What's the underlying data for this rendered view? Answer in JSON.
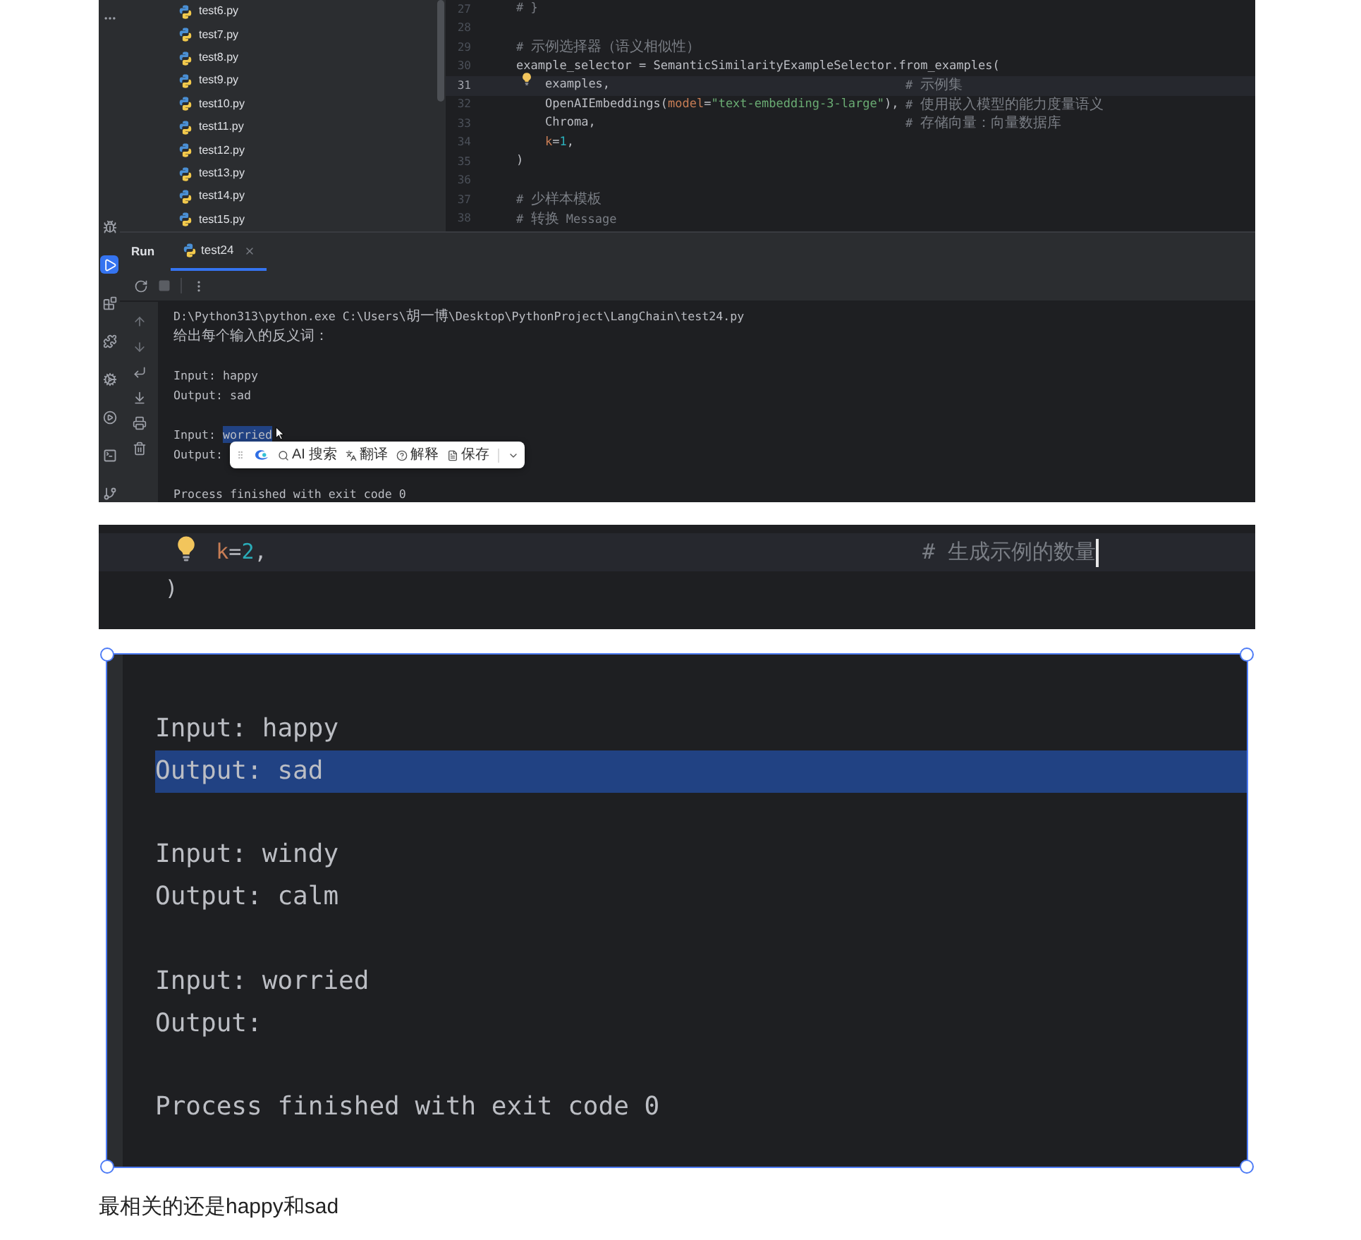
{
  "screenshot_1": {
    "tool_strip": {
      "top": [
        {
          "kind": "more",
          "selected": false
        }
      ],
      "bottom": [
        {
          "kind": "debug",
          "selected": false
        },
        {
          "kind": "run",
          "selected": true
        },
        {
          "kind": "packages",
          "selected": false
        },
        {
          "kind": "plugins",
          "selected": false
        },
        {
          "kind": "settings",
          "selected": false
        },
        {
          "kind": "services",
          "selected": false
        },
        {
          "kind": "terminal",
          "selected": false
        },
        {
          "kind": "git",
          "selected": false
        }
      ]
    },
    "project_tree": {
      "items": [
        {
          "label": "test6.py"
        },
        {
          "label": "test7.py"
        },
        {
          "label": "test8.py"
        },
        {
          "label": "test9.py"
        },
        {
          "label": "test10.py"
        },
        {
          "label": "test11.py"
        },
        {
          "label": "test12.py"
        },
        {
          "label": "test13.py"
        },
        {
          "label": "test14.py"
        },
        {
          "label": "test15.py"
        }
      ]
    },
    "editor": {
      "lines": [
        {
          "number": "27",
          "current": false,
          "tokens": [
            {
              "kind": "comment",
              "text": "# }"
            }
          ]
        },
        {
          "number": "28",
          "current": false
        },
        {
          "number": "29",
          "current": false,
          "tokens": [
            {
              "kind": "comment",
              "text": "# 示例选择器（语义相似性）"
            }
          ]
        },
        {
          "number": "30",
          "current": false,
          "tokens": [
            {
              "kind": "plain",
              "text": "example_selector = SemanticSimilarityExampleSelector.from_examples("
            }
          ]
        },
        {
          "number": "31",
          "current": true,
          "tokens": [
            {
              "kind": "plain",
              "text": "    examples,"
            }
          ],
          "comment": "# 示例集"
        },
        {
          "number": "32",
          "current": false,
          "tokens": [
            {
              "kind": "plain",
              "text": "    OpenAIEmbeddings("
            },
            {
              "kind": "kwarg",
              "text": "model"
            },
            {
              "kind": "plain",
              "text": "="
            },
            {
              "kind": "string",
              "text": "\"text-embedding-3-large\""
            },
            {
              "kind": "plain",
              "text": "),"
            }
          ],
          "comment": "# 使用嵌入模型的能力度量语义"
        },
        {
          "number": "33",
          "current": false,
          "tokens": [
            {
              "kind": "plain",
              "text": "    Chroma,"
            }
          ],
          "comment": "# 存储向量：向量数据库"
        },
        {
          "number": "34",
          "current": false,
          "tokens": [
            {
              "kind": "kwarg",
              "text": "    k"
            },
            {
              "kind": "plain",
              "text": "="
            },
            {
              "kind": "number",
              "text": "1"
            },
            {
              "kind": "plain",
              "text": ","
            }
          ]
        },
        {
          "number": "35",
          "current": false,
          "tokens": [
            {
              "kind": "plain",
              "text": ")"
            }
          ]
        },
        {
          "number": "36",
          "current": false
        },
        {
          "number": "37",
          "current": false,
          "tokens": [
            {
              "kind": "comment",
              "text": "# 少样本模板"
            }
          ]
        },
        {
          "number": "38",
          "current": false,
          "tokens": [
            {
              "kind": "comment",
              "text": "# 转换 Message"
            }
          ]
        }
      ]
    },
    "run_panel": {
      "title": "Run",
      "tabs": [
        {
          "label": "test24",
          "selected": true
        }
      ],
      "console_groups": [
        [
          {
            "segments": [
              {
                "text": "D:\\Python313\\python.exe C:\\Users\\胡一博\\Desktop\\PythonProject\\LangChain\\test24.py",
                "selected": false
              }
            ]
          },
          {
            "segments": [
              {
                "text": "给出每个输入的反义词：",
                "selected": false
              }
            ]
          }
        ],
        [
          {
            "segments": [
              {
                "text": "Input: happy",
                "selected": false
              }
            ]
          },
          {
            "segments": [
              {
                "text": "Output: sad",
                "selected": false
              }
            ]
          }
        ],
        [
          {
            "segments": [
              {
                "text": "Input: ",
                "selected": false
              },
              {
                "text": "worried",
                "selected": true
              }
            ]
          },
          {
            "segments": [
              {
                "text": "Output:",
                "selected": false
              }
            ]
          }
        ],
        [
          {
            "segments": [
              {
                "text": "Process finished with exit code 0",
                "selected": false
              }
            ]
          }
        ]
      ]
    },
    "selection_popup": {
      "items": [
        {
          "kind": "search",
          "label": "AI 搜索"
        },
        {
          "kind": "translate",
          "label": "翻译"
        },
        {
          "kind": "explain",
          "label": "解释"
        },
        {
          "kind": "save",
          "label": "保存"
        }
      ]
    }
  },
  "screenshot_2": {
    "lines": [
      {
        "current": true,
        "caret": true,
        "tokens": [
          {
            "kind": "kwarg",
            "text": "    k"
          },
          {
            "kind": "plain",
            "text": "="
          },
          {
            "kind": "number",
            "text": "2"
          },
          {
            "kind": "plain",
            "text": ","
          }
        ],
        "comment": "# 生成示例的数量"
      },
      {
        "current": false,
        "tokens": [
          {
            "kind": "plain",
            "text": ")"
          }
        ]
      }
    ]
  },
  "screenshot_3": {
    "selected": true,
    "console_groups": [
      [
        {
          "text": "Input: happy",
          "selected": false
        },
        {
          "text": "Output: sad",
          "selected": true
        }
      ],
      [
        {
          "text": "Input: windy",
          "selected": false
        },
        {
          "text": "Output: calm",
          "selected": false
        }
      ],
      [
        {
          "text": "Input: worried",
          "selected": false
        },
        {
          "text": "Output:",
          "selected": false
        }
      ],
      [
        {
          "text": "Process finished with exit code 0",
          "selected": false
        }
      ]
    ]
  },
  "caption": "最相关的还是happy和sad"
}
